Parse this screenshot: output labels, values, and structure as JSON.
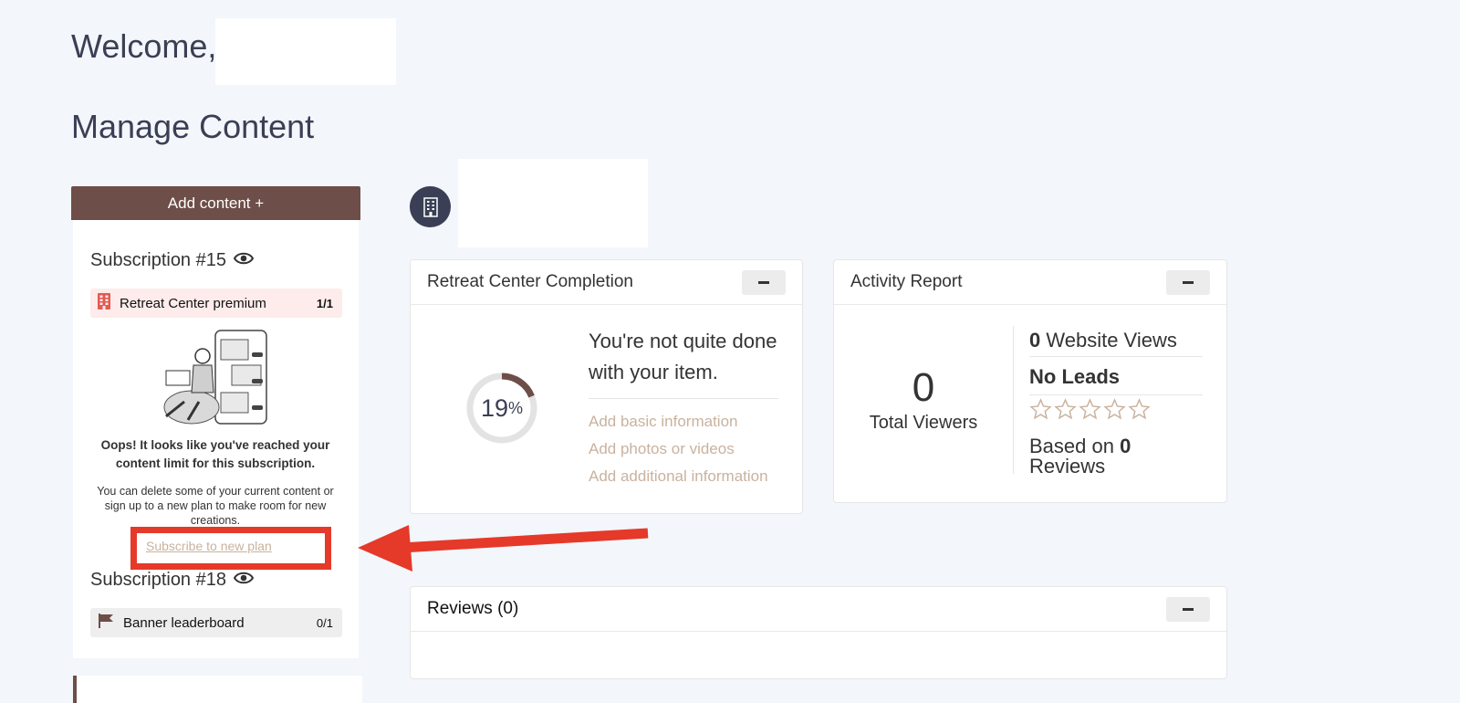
{
  "header": {
    "welcome": "Welcome,",
    "manage_title": "Manage Content"
  },
  "left": {
    "add_button": "Add content +",
    "subscriptions": [
      {
        "title": "Subscription #15",
        "item_label": "Retreat Center premium",
        "item_count": "1/1",
        "item_icon": "building-icon",
        "item_bg": "#fdeceb"
      },
      {
        "title": "Subscription #18",
        "item_label": "Banner leaderboard",
        "item_count": "0/1",
        "item_icon": "flag-icon",
        "item_bg": "#eeeeee"
      }
    ],
    "oops_text": "Oops! It looks like you've reached your content limit for this subscription.",
    "help_text": "You can delete some of your current content or sign up to a new plan to make room for new creations.",
    "subscribe_link": "Subscribe to new plan"
  },
  "completion": {
    "title": "Retreat Center Completion",
    "percent_number": "19",
    "percent_sign": "%",
    "progress": 0.19,
    "message": "You're not quite done with your item.",
    "todos": [
      "Add basic information",
      "Add photos or videos",
      "Add additional information"
    ]
  },
  "activity": {
    "title": "Activity Report",
    "total_viewers_value": "0",
    "total_viewers_label": "Total Viewers",
    "website_views_value": "0",
    "website_views_label": "Website Views",
    "leads_label": "No Leads",
    "rating_stars": 0,
    "based_on_prefix": "Based on",
    "reviews_count": "0",
    "reviews_word": "Reviews"
  },
  "reviews": {
    "title": "Reviews (0)"
  },
  "colors": {
    "accent_brown": "#6e4e48",
    "navy": "#3a3f55",
    "link_tan": "#c9b29e",
    "annotation_red": "#e5392a"
  }
}
